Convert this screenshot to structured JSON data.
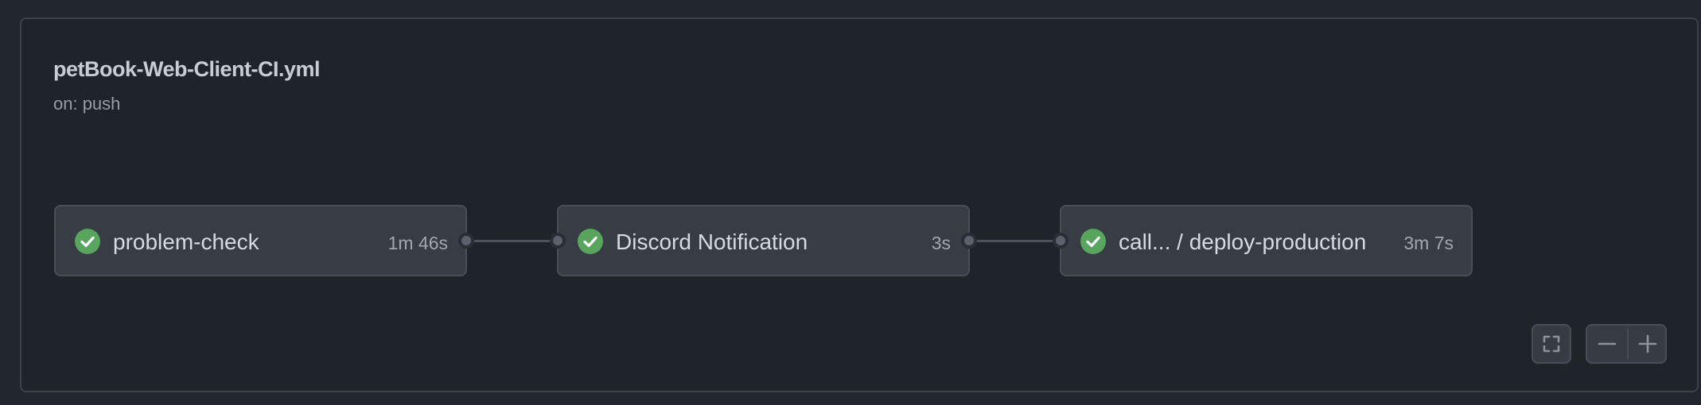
{
  "workflow": {
    "title": "petBook-Web-Client-CI.yml",
    "trigger": "on: push"
  },
  "jobs": [
    {
      "name": "problem-check",
      "duration": "1m 46s",
      "status": "success"
    },
    {
      "name": "Discord Notification",
      "duration": "3s",
      "status": "success"
    },
    {
      "name": "call...  / deploy-production",
      "duration": "3m 7s",
      "status": "success"
    }
  ],
  "controls": {
    "fullscreen_icon": "fullscreen-icon",
    "zoom_out_icon": "minus-icon",
    "zoom_in_icon": "plus-icon"
  },
  "colors": {
    "success": "#58a55d",
    "background": "#1f232a",
    "job_card": "#373c45"
  }
}
